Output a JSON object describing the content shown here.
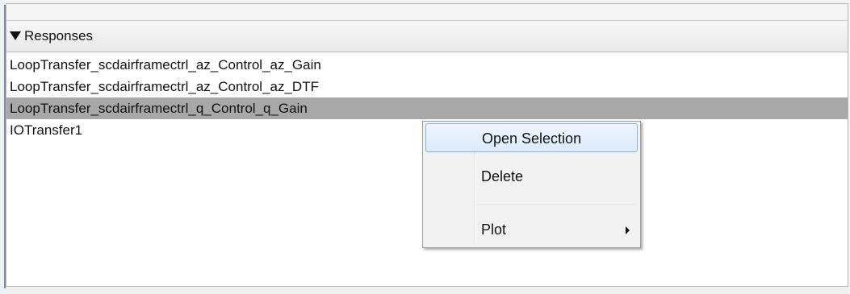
{
  "responses_panel": {
    "header_title": "Responses",
    "items": [
      {
        "label": "LoopTransfer_scdairframectrl_az_Control_az_Gain",
        "selected": false
      },
      {
        "label": "LoopTransfer_scdairframectrl_az_Control_az_DTF",
        "selected": false
      },
      {
        "label": "LoopTransfer_scdairframectrl_q_Control_q_Gain",
        "selected": true
      },
      {
        "label": "IOTransfer1",
        "selected": false
      }
    ]
  },
  "context_menu": {
    "items": [
      {
        "label": "Open Selection",
        "highlighted": true
      },
      {
        "label": "Delete"
      },
      {
        "label": "Plot",
        "has_submenu": true
      }
    ]
  },
  "colors": {
    "selection_gray": "#a8a8a8",
    "menu_highlight_border": "#7eb4ea"
  }
}
